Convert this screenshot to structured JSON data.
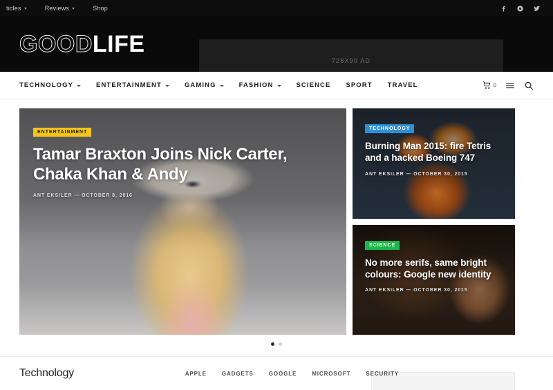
{
  "topbar": {
    "nav": [
      {
        "label": "ticles",
        "has_caret": true
      },
      {
        "label": "Reviews",
        "has_caret": true
      },
      {
        "label": "Shop",
        "has_caret": false
      }
    ],
    "social": [
      {
        "name": "facebook-icon"
      },
      {
        "name": "pinterest-icon"
      },
      {
        "name": "twitter-icon"
      }
    ],
    "bg_color": "#0d0d0d"
  },
  "masthead": {
    "logo_part1": "GOOD",
    "logo_part2": "LIFE",
    "ad_label": "728X90 AD",
    "bg_color": "#0a0a0a"
  },
  "mainnav": {
    "items": [
      {
        "label": "TECHNOLOGY",
        "has_caret": true
      },
      {
        "label": "ENTERTAINMENT",
        "has_caret": true
      },
      {
        "label": "GAMING",
        "has_caret": true
      },
      {
        "label": "FASHION",
        "has_caret": true
      },
      {
        "label": "SCIENCE",
        "has_caret": false
      },
      {
        "label": "SPORT",
        "has_caret": false
      },
      {
        "label": "TRAVEL",
        "has_caret": false
      }
    ],
    "cart_count": "0"
  },
  "hero": {
    "main": {
      "badge": "ENTERTAINMENT",
      "badge_color": "#f5c518",
      "title": "Tamar Braxton Joins Nick Carter, Chaka Khan & Andy",
      "author": "ANT EKSILER",
      "date": "OCTOBER 8, 2016",
      "meta": "ANT EKSILER  —  OCTOBER 8, 2016"
    },
    "cards": [
      {
        "badge": "TECHNOLOGY",
        "badge_color": "#2f8fd6",
        "title": "Burning Man 2015: fire Tetris and a hacked Boeing 747",
        "author": "ANT EKSILER",
        "date": "OCTOBER 30, 2015",
        "meta": "ANT EKSILER  —  OCTOBER 30, 2015"
      },
      {
        "badge": "SCIENCE",
        "badge_color": "#19b84a",
        "title": "No more serifs, same bright colours: Google new identity",
        "author": "ANT EKSILER",
        "date": "OCTOBER 30, 2015",
        "meta": "ANT EKSILER  —  OCTOBER 30, 2015"
      }
    ],
    "dots": [
      {
        "active": true
      },
      {
        "active": false
      }
    ]
  },
  "section": {
    "title": "Technology",
    "filters": [
      "APPLE",
      "GADGETS",
      "GOOGLE",
      "MICROSOFT",
      "SECURITY"
    ]
  }
}
